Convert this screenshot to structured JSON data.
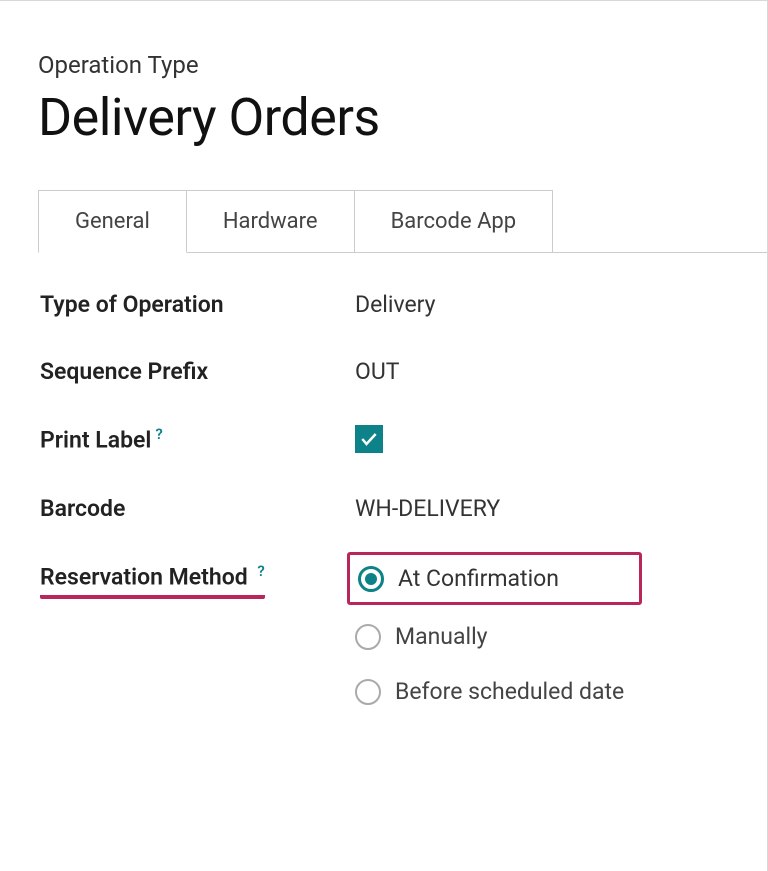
{
  "breadcrumb": "Operation Type",
  "title": "Delivery Orders",
  "tabs": [
    {
      "label": "General",
      "active": true
    },
    {
      "label": "Hardware",
      "active": false
    },
    {
      "label": "Barcode App",
      "active": false
    }
  ],
  "fields": {
    "type_of_operation": {
      "label": "Type of Operation",
      "value": "Delivery"
    },
    "sequence_prefix": {
      "label": "Sequence Prefix",
      "value": "OUT"
    },
    "print_label": {
      "label": "Print Label",
      "checked": true
    },
    "barcode": {
      "label": "Barcode",
      "value": "WH-DELIVERY"
    },
    "reservation_method": {
      "label": "Reservation Method",
      "options": [
        {
          "label": "At Confirmation",
          "selected": true
        },
        {
          "label": "Manually",
          "selected": false
        },
        {
          "label": "Before scheduled date",
          "selected": false
        }
      ]
    }
  },
  "help_glyph": "?"
}
